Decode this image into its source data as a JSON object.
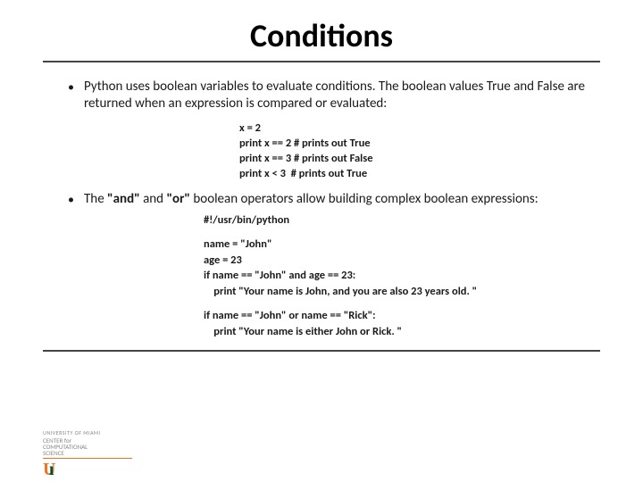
{
  "title": "Conditions",
  "bullets": [
    "Python uses boolean variables to evaluate conditions. The boolean values True and False are returned when an expression is compared or evaluated:",
    "The \"and\" and \"or\" boolean operators allow building complex boolean expressions:"
  ],
  "code1": [
    "x = 2",
    "print x == 2 # prints out True",
    "print x == 3 # prints out False",
    "print x < 3  # prints out True"
  ],
  "code2": [
    "#!/usr/bin/python",
    "",
    "name = \"John\"",
    "age = 23",
    "if name == \"John\" and age == 23:",
    "    print \"Your name is John, and you are also 23 years old. \"",
    "",
    "if name == \"John\" or name == \"Rick\":",
    "    print \"Your name is either John or Rick. \""
  ],
  "footer": {
    "l1": "UNIVERSITY OF MIAMI",
    "l2": "CENTER for",
    "l3": "COMPUTATIONAL",
    "l4": "SCIENCE"
  }
}
